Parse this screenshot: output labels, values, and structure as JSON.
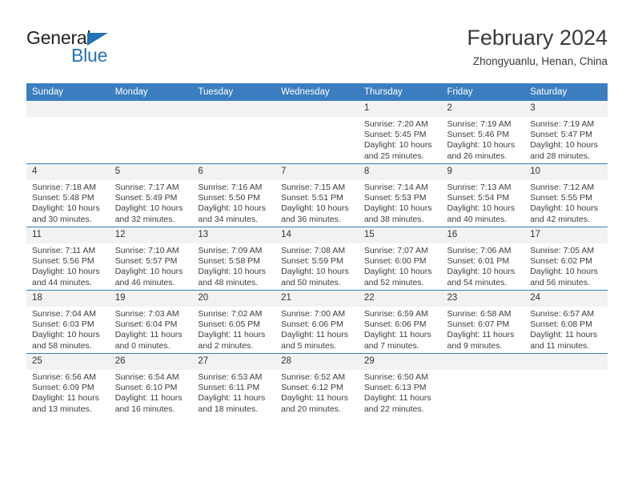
{
  "brand": {
    "name_top": "General",
    "name_bottom": "Blue",
    "triangle_icon": "triangle-icon",
    "color_dark": "#231f20",
    "color_blue": "#2572b6"
  },
  "header": {
    "month_title": "February 2024",
    "location": "Zhongyuanlu, Henan, China"
  },
  "theme": {
    "header_blue": "#3b7ebf",
    "daynum_band": "#f2f2f2",
    "text": "#333333"
  },
  "weekday_headers": [
    "Sunday",
    "Monday",
    "Tuesday",
    "Wednesday",
    "Thursday",
    "Friday",
    "Saturday"
  ],
  "weeks": [
    [
      {
        "day": "",
        "empty": true,
        "sunrise": "",
        "sunset": "",
        "daylight": ""
      },
      {
        "day": "",
        "empty": true,
        "sunrise": "",
        "sunset": "",
        "daylight": ""
      },
      {
        "day": "",
        "empty": true,
        "sunrise": "",
        "sunset": "",
        "daylight": ""
      },
      {
        "day": "",
        "empty": true,
        "sunrise": "",
        "sunset": "",
        "daylight": ""
      },
      {
        "day": "1",
        "empty": false,
        "sunrise": "Sunrise: 7:20 AM",
        "sunset": "Sunset: 5:45 PM",
        "daylight": "Daylight: 10 hours and 25 minutes."
      },
      {
        "day": "2",
        "empty": false,
        "sunrise": "Sunrise: 7:19 AM",
        "sunset": "Sunset: 5:46 PM",
        "daylight": "Daylight: 10 hours and 26 minutes."
      },
      {
        "day": "3",
        "empty": false,
        "sunrise": "Sunrise: 7:19 AM",
        "sunset": "Sunset: 5:47 PM",
        "daylight": "Daylight: 10 hours and 28 minutes."
      }
    ],
    [
      {
        "day": "4",
        "empty": false,
        "sunrise": "Sunrise: 7:18 AM",
        "sunset": "Sunset: 5:48 PM",
        "daylight": "Daylight: 10 hours and 30 minutes."
      },
      {
        "day": "5",
        "empty": false,
        "sunrise": "Sunrise: 7:17 AM",
        "sunset": "Sunset: 5:49 PM",
        "daylight": "Daylight: 10 hours and 32 minutes."
      },
      {
        "day": "6",
        "empty": false,
        "sunrise": "Sunrise: 7:16 AM",
        "sunset": "Sunset: 5:50 PM",
        "daylight": "Daylight: 10 hours and 34 minutes."
      },
      {
        "day": "7",
        "empty": false,
        "sunrise": "Sunrise: 7:15 AM",
        "sunset": "Sunset: 5:51 PM",
        "daylight": "Daylight: 10 hours and 36 minutes."
      },
      {
        "day": "8",
        "empty": false,
        "sunrise": "Sunrise: 7:14 AM",
        "sunset": "Sunset: 5:53 PM",
        "daylight": "Daylight: 10 hours and 38 minutes."
      },
      {
        "day": "9",
        "empty": false,
        "sunrise": "Sunrise: 7:13 AM",
        "sunset": "Sunset: 5:54 PM",
        "daylight": "Daylight: 10 hours and 40 minutes."
      },
      {
        "day": "10",
        "empty": false,
        "sunrise": "Sunrise: 7:12 AM",
        "sunset": "Sunset: 5:55 PM",
        "daylight": "Daylight: 10 hours and 42 minutes."
      }
    ],
    [
      {
        "day": "11",
        "empty": false,
        "sunrise": "Sunrise: 7:11 AM",
        "sunset": "Sunset: 5:56 PM",
        "daylight": "Daylight: 10 hours and 44 minutes."
      },
      {
        "day": "12",
        "empty": false,
        "sunrise": "Sunrise: 7:10 AM",
        "sunset": "Sunset: 5:57 PM",
        "daylight": "Daylight: 10 hours and 46 minutes."
      },
      {
        "day": "13",
        "empty": false,
        "sunrise": "Sunrise: 7:09 AM",
        "sunset": "Sunset: 5:58 PM",
        "daylight": "Daylight: 10 hours and 48 minutes."
      },
      {
        "day": "14",
        "empty": false,
        "sunrise": "Sunrise: 7:08 AM",
        "sunset": "Sunset: 5:59 PM",
        "daylight": "Daylight: 10 hours and 50 minutes."
      },
      {
        "day": "15",
        "empty": false,
        "sunrise": "Sunrise: 7:07 AM",
        "sunset": "Sunset: 6:00 PM",
        "daylight": "Daylight: 10 hours and 52 minutes."
      },
      {
        "day": "16",
        "empty": false,
        "sunrise": "Sunrise: 7:06 AM",
        "sunset": "Sunset: 6:01 PM",
        "daylight": "Daylight: 10 hours and 54 minutes."
      },
      {
        "day": "17",
        "empty": false,
        "sunrise": "Sunrise: 7:05 AM",
        "sunset": "Sunset: 6:02 PM",
        "daylight": "Daylight: 10 hours and 56 minutes."
      }
    ],
    [
      {
        "day": "18",
        "empty": false,
        "sunrise": "Sunrise: 7:04 AM",
        "sunset": "Sunset: 6:03 PM",
        "daylight": "Daylight: 10 hours and 58 minutes."
      },
      {
        "day": "19",
        "empty": false,
        "sunrise": "Sunrise: 7:03 AM",
        "sunset": "Sunset: 6:04 PM",
        "daylight": "Daylight: 11 hours and 0 minutes."
      },
      {
        "day": "20",
        "empty": false,
        "sunrise": "Sunrise: 7:02 AM",
        "sunset": "Sunset: 6:05 PM",
        "daylight": "Daylight: 11 hours and 2 minutes."
      },
      {
        "day": "21",
        "empty": false,
        "sunrise": "Sunrise: 7:00 AM",
        "sunset": "Sunset: 6:06 PM",
        "daylight": "Daylight: 11 hours and 5 minutes."
      },
      {
        "day": "22",
        "empty": false,
        "sunrise": "Sunrise: 6:59 AM",
        "sunset": "Sunset: 6:06 PM",
        "daylight": "Daylight: 11 hours and 7 minutes."
      },
      {
        "day": "23",
        "empty": false,
        "sunrise": "Sunrise: 6:58 AM",
        "sunset": "Sunset: 6:07 PM",
        "daylight": "Daylight: 11 hours and 9 minutes."
      },
      {
        "day": "24",
        "empty": false,
        "sunrise": "Sunrise: 6:57 AM",
        "sunset": "Sunset: 6:08 PM",
        "daylight": "Daylight: 11 hours and 11 minutes."
      }
    ],
    [
      {
        "day": "25",
        "empty": false,
        "sunrise": "Sunrise: 6:56 AM",
        "sunset": "Sunset: 6:09 PM",
        "daylight": "Daylight: 11 hours and 13 minutes."
      },
      {
        "day": "26",
        "empty": false,
        "sunrise": "Sunrise: 6:54 AM",
        "sunset": "Sunset: 6:10 PM",
        "daylight": "Daylight: 11 hours and 16 minutes."
      },
      {
        "day": "27",
        "empty": false,
        "sunrise": "Sunrise: 6:53 AM",
        "sunset": "Sunset: 6:11 PM",
        "daylight": "Daylight: 11 hours and 18 minutes."
      },
      {
        "day": "28",
        "empty": false,
        "sunrise": "Sunrise: 6:52 AM",
        "sunset": "Sunset: 6:12 PM",
        "daylight": "Daylight: 11 hours and 20 minutes."
      },
      {
        "day": "29",
        "empty": false,
        "sunrise": "Sunrise: 6:50 AM",
        "sunset": "Sunset: 6:13 PM",
        "daylight": "Daylight: 11 hours and 22 minutes."
      },
      {
        "day": "",
        "empty": true,
        "sunrise": "",
        "sunset": "",
        "daylight": ""
      },
      {
        "day": "",
        "empty": true,
        "sunrise": "",
        "sunset": "",
        "daylight": ""
      }
    ]
  ]
}
